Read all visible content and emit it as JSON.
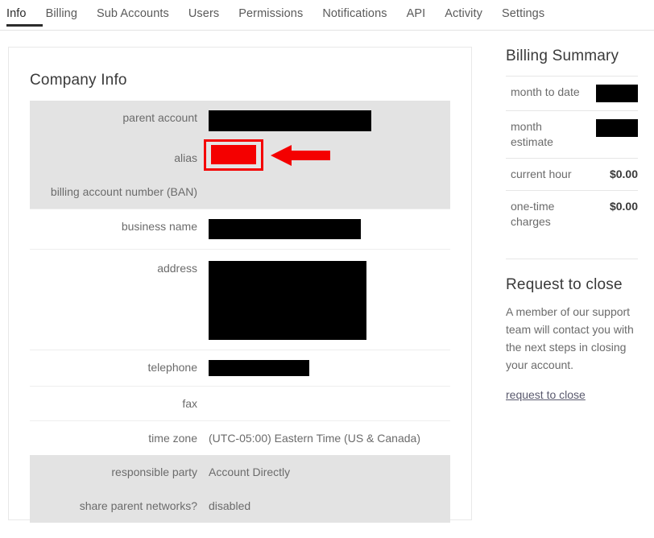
{
  "nav": {
    "tabs": [
      {
        "label": "Info",
        "active": true
      },
      {
        "label": "Billing",
        "active": false
      },
      {
        "label": "Sub Accounts",
        "active": false
      },
      {
        "label": "Users",
        "active": false
      },
      {
        "label": "Permissions",
        "active": false
      },
      {
        "label": "Notifications",
        "active": false
      },
      {
        "label": "API",
        "active": false
      },
      {
        "label": "Activity",
        "active": false
      },
      {
        "label": "Settings",
        "active": false
      }
    ]
  },
  "company_info": {
    "title": "Company Info",
    "rows": [
      {
        "label": "parent account",
        "value": "",
        "redacted": true,
        "redact_w": 202,
        "redact_h": 26,
        "shaded": true
      },
      {
        "label": "alias",
        "value": "",
        "redacted": false,
        "shaded": true
      },
      {
        "label": "billing account number (BAN)",
        "value": "",
        "redacted": false,
        "shaded": true
      },
      {
        "label": "business name",
        "value": "",
        "redacted": true,
        "redact_w": 189,
        "redact_h": 25,
        "shaded": false
      },
      {
        "label": "address",
        "value": "",
        "redacted": true,
        "redact_w": 196,
        "redact_h": 98,
        "shaded": false
      },
      {
        "label": "telephone",
        "value": "",
        "redacted": true,
        "redact_w": 125,
        "redact_h": 20,
        "shaded": false
      },
      {
        "label": "fax",
        "value": "",
        "redacted": false,
        "shaded": false
      },
      {
        "label": "time zone",
        "value": "(UTC-05:00) Eastern Time (US & Canada)",
        "redacted": false,
        "shaded": false
      },
      {
        "label": "responsible party",
        "value": "Account Directly",
        "redacted": false,
        "shaded": true
      },
      {
        "label": "share parent networks?",
        "value": "disabled",
        "redacted": false,
        "shaded": true
      }
    ]
  },
  "annotation": {
    "color": "#f40000",
    "highlight_box": "alias-value-highlight",
    "arrow": "left-pointing-arrow"
  },
  "billing_summary": {
    "title": "Billing Summary",
    "rows": [
      {
        "label": "month to date",
        "value": "",
        "redacted": true,
        "redact_w": 52,
        "redact_h": 22
      },
      {
        "label": "month estimate",
        "value": "",
        "redacted": true,
        "redact_w": 52,
        "redact_h": 22
      },
      {
        "label": "current hour",
        "value": "$0.00",
        "redacted": false
      },
      {
        "label": "one-time charges",
        "value": "$0.00",
        "redacted": false
      }
    ]
  },
  "request_to_close": {
    "title": "Request to close",
    "paragraph": "A member of our support team will contact you with the next steps in closing your account.",
    "link_label": "request to close"
  }
}
